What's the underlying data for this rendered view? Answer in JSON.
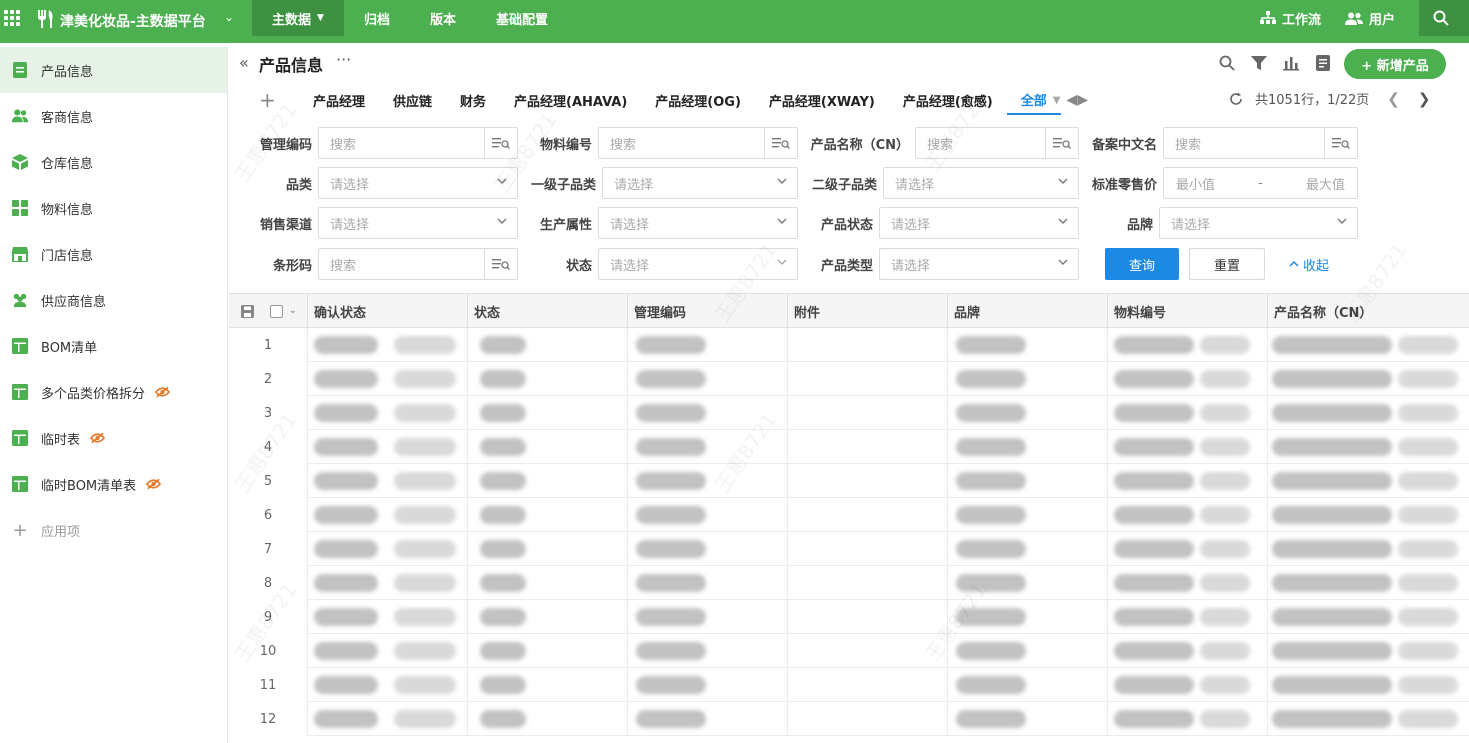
{
  "app": {
    "name": "津美化妆品-主数据平台"
  },
  "topnav": [
    {
      "label": "主数据",
      "active": true,
      "dropdown": true
    },
    {
      "label": "归档"
    },
    {
      "label": "版本"
    },
    {
      "label": "基础配置"
    }
  ],
  "topright": {
    "workflow": "工作流",
    "user": "用户"
  },
  "sidebar": {
    "items": [
      {
        "label": "产品信息",
        "icon": "document-icon",
        "active": true
      },
      {
        "label": "客商信息",
        "icon": "people-icon"
      },
      {
        "label": "仓库信息",
        "icon": "box-icon"
      },
      {
        "label": "物料信息",
        "icon": "grid-icon"
      },
      {
        "label": "门店信息",
        "icon": "store-icon"
      },
      {
        "label": "供应商信息",
        "icon": "people-icon"
      },
      {
        "label": "BOM清单",
        "icon": "table-icon"
      },
      {
        "label": "多个品类价格拆分",
        "icon": "table-icon",
        "hidden": true
      },
      {
        "label": "临时表",
        "icon": "table-icon",
        "hidden": true
      },
      {
        "label": "临时BOM清单表",
        "icon": "table-icon",
        "hidden": true
      }
    ],
    "add_label": "应用项"
  },
  "page": {
    "title": "产品信息",
    "back": "«",
    "more": "···",
    "add_button": "+ 新增产品"
  },
  "tabs": [
    {
      "label": "产品经理"
    },
    {
      "label": "供应链"
    },
    {
      "label": "财务"
    },
    {
      "label": "产品经理(AHAVA)"
    },
    {
      "label": "产品经理(OG)"
    },
    {
      "label": "产品经理(XWAY)"
    },
    {
      "label": "产品经理(愈感)"
    },
    {
      "label": "全部",
      "active": true
    }
  ],
  "pager": {
    "summary": "共1051行，1/22页"
  },
  "filters": {
    "mgmt_code": {
      "label": "管理编码",
      "placeholder": "搜索"
    },
    "material_no": {
      "label": "物料编号",
      "placeholder": "搜索"
    },
    "product_name": {
      "label": "产品名称（CN）",
      "placeholder": "搜索"
    },
    "record_name": {
      "label": "备案中文名",
      "placeholder": "搜索"
    },
    "category": {
      "label": "品类",
      "placeholder": "请选择"
    },
    "sub1": {
      "label": "一级子品类",
      "placeholder": "请选择"
    },
    "sub2": {
      "label": "二级子品类",
      "placeholder": "请选择"
    },
    "price": {
      "label": "标准零售价",
      "min": "最小值",
      "sep": "-",
      "max": "最大值"
    },
    "channel": {
      "label": "销售渠道",
      "placeholder": "请选择"
    },
    "prod_attr": {
      "label": "生产属性",
      "placeholder": "请选择"
    },
    "prod_status": {
      "label": "产品状态",
      "placeholder": "请选择"
    },
    "brand": {
      "label": "品牌",
      "placeholder": "请选择"
    },
    "barcode": {
      "label": "条形码",
      "placeholder": "搜索"
    },
    "status": {
      "label": "状态",
      "placeholder": "请选择"
    },
    "prod_type": {
      "label": "产品类型",
      "placeholder": "请选择"
    },
    "query_button": "查询",
    "reset_button": "重置",
    "collapse": "收起"
  },
  "table": {
    "columns": [
      "确认状态",
      "状态",
      "管理编码",
      "附件",
      "品牌",
      "物料编号",
      "产品名称（CN）"
    ],
    "rows": [
      "1",
      "2",
      "3",
      "4",
      "5",
      "6",
      "7",
      "8",
      "9",
      "10",
      "11",
      "12"
    ]
  },
  "colors": {
    "brand": "#4caf50",
    "accent": "#1e88e5"
  }
}
